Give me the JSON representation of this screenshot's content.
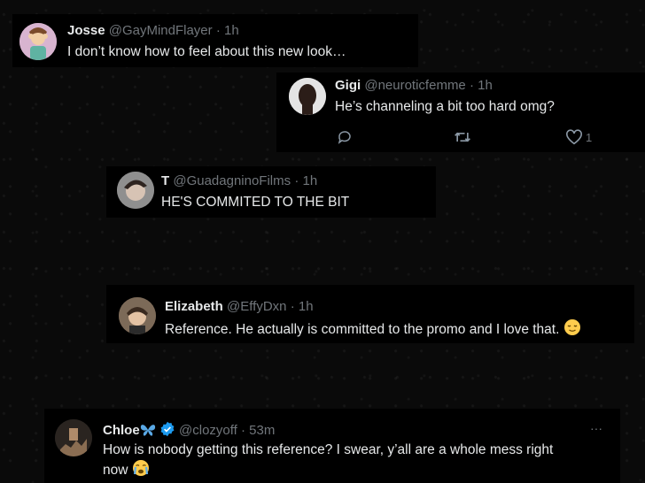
{
  "replies": [
    {
      "name": "Josse",
      "handle": "@GayMindFlayer",
      "sep": "·",
      "time": "1h",
      "text": "I don’t know how to feel about this new look…"
    },
    {
      "name": "Gigi",
      "handle": "@neuroticfemme",
      "sep": "·",
      "time": "1h",
      "text": "He’s channeling a bit too hard omg?",
      "likes": "1"
    },
    {
      "name": "T",
      "handle": "@GuadagninoFilms",
      "sep": "·",
      "time": "1h",
      "text": "HE'S COMMITED TO THE BIT"
    },
    {
      "name": "Elizabeth",
      "handle": "@EffyDxn",
      "sep": "·",
      "time": "1h",
      "text": "Reference. He actually is committed to the promo and I love that."
    },
    {
      "name": "Chloe",
      "handle": "@clozyoff",
      "sep": "·",
      "time": "53m",
      "text_line1": "How is nobody getting this reference? I swear, y’all are a whole mess right",
      "text_line2": "now",
      "more": "···"
    }
  ],
  "icons": {
    "reply": "reply-icon",
    "retweet": "retweet-icon",
    "like": "heart-icon",
    "verified": "verified-badge-icon",
    "butterfly": "butterfly-emoji-icon",
    "relieved": "relieved-face-emoji-icon",
    "crying": "crying-face-emoji-icon"
  },
  "colors": {
    "background": "#000000",
    "text": "#e7e9ea",
    "muted": "#71767b",
    "verified": "#1d9bf0"
  }
}
